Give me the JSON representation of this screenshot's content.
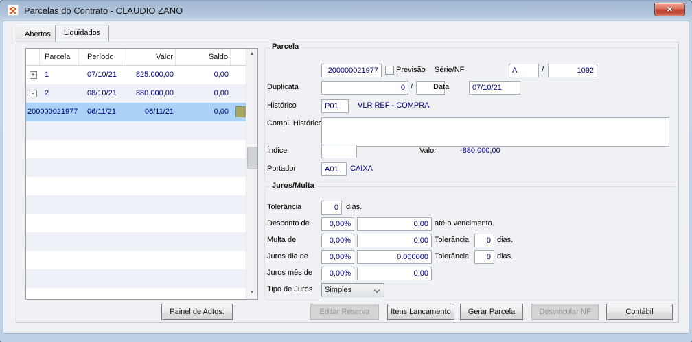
{
  "window": {
    "title": "Parcelas do Contrato - CLAUDIO ZANO",
    "close_glyph": "×"
  },
  "icons": {
    "app": "app-icon",
    "close": "close-icon",
    "tree_expand": "tree-expand-icon",
    "tree_collapse": "tree-collapse-icon",
    "scroll_up": "scroll-up-icon",
    "scroll_down": "scroll-down-icon",
    "combo_chevron": "chevron-down-icon"
  },
  "colors": {
    "selected_row": "#abd3f7",
    "alt_row": "#eef1f8",
    "value_text": "#00007d",
    "close_button": "#c04a33",
    "row_indicator": "#a7a566",
    "titlebar": "#b3c7dd"
  },
  "tabs": [
    {
      "label": "Abertos",
      "active": false
    },
    {
      "label": "Liquidados",
      "active": true
    }
  ],
  "table": {
    "columns": [
      "Parcela",
      "Período",
      "Valor",
      "Saldo"
    ],
    "scroll_up_glyph": "▲",
    "scroll_down_glyph": "▼",
    "rows": [
      {
        "tree": "+",
        "parcela": "1",
        "periodo": "07/10/21",
        "valor": "825.000,00",
        "saldo": "0,00"
      },
      {
        "tree": "-",
        "parcela": "2",
        "periodo": "08/10/21",
        "valor": "880.000,00",
        "saldo": "0,00"
      },
      {
        "tree": "",
        "parcela": "200000021977",
        "periodo": "06/11/21",
        "valor": "06/11/21",
        "saldo": "0,00"
      }
    ]
  },
  "parcela_group": {
    "title": "Parcela",
    "numero": "200000021977",
    "previsao_label": "Previsão",
    "serie_nf_label": "Série/NF",
    "serie": "A",
    "separator": "/",
    "nf": "1092",
    "duplicata_label": "Duplicata",
    "duplicata": "0",
    "duplicata_seq": "",
    "data_label": "Data",
    "data": "07/10/21",
    "historico_label": "Histórico",
    "historico_code": "P01",
    "historico_desc": "VLR REF - COMPRA",
    "compl_historico_label": "Compl. Histórico",
    "compl_historico": "",
    "indice_label": "Índice",
    "indice": "",
    "valor_label": "Valor",
    "valor": "-880.000,00",
    "portador_label": "Portador",
    "portador_code": "A01",
    "portador_desc": "CAIXA"
  },
  "juros_group": {
    "title": "Juros/Multa",
    "tolerancia_label": "Tolerância",
    "tolerancia": "0",
    "dias_label": "dias.",
    "desconto_label": "Desconto de",
    "desconto_pct": "0,00%",
    "desconto_valor": "0,00",
    "desconto_suffix": "até o vencimento.",
    "multa_label": "Multa de",
    "multa_pct": "0,00%",
    "multa_valor": "0,00",
    "multa_tolerancia": "0",
    "juros_dia_label": "Juros dia de",
    "juros_dia_pct": "0,00%",
    "juros_dia_valor": "0,000000",
    "juros_dia_tolerancia": "0",
    "juros_mes_label": "Juros mês de",
    "juros_mes_pct": "0,00%",
    "juros_mes_valor": "0,00",
    "tipo_label": "Tipo de Juros",
    "tipo_valor": "Simples"
  },
  "buttons": {
    "painel_adtos": "Painel de Adtos.",
    "editar_reserva": "Editar Reserva",
    "itens_lancamento": "Itens Lancamento",
    "gerar_parcela": "Gerar Parcela",
    "desvincular_nf": "Desvincular NF",
    "contabil": "Contábil"
  }
}
